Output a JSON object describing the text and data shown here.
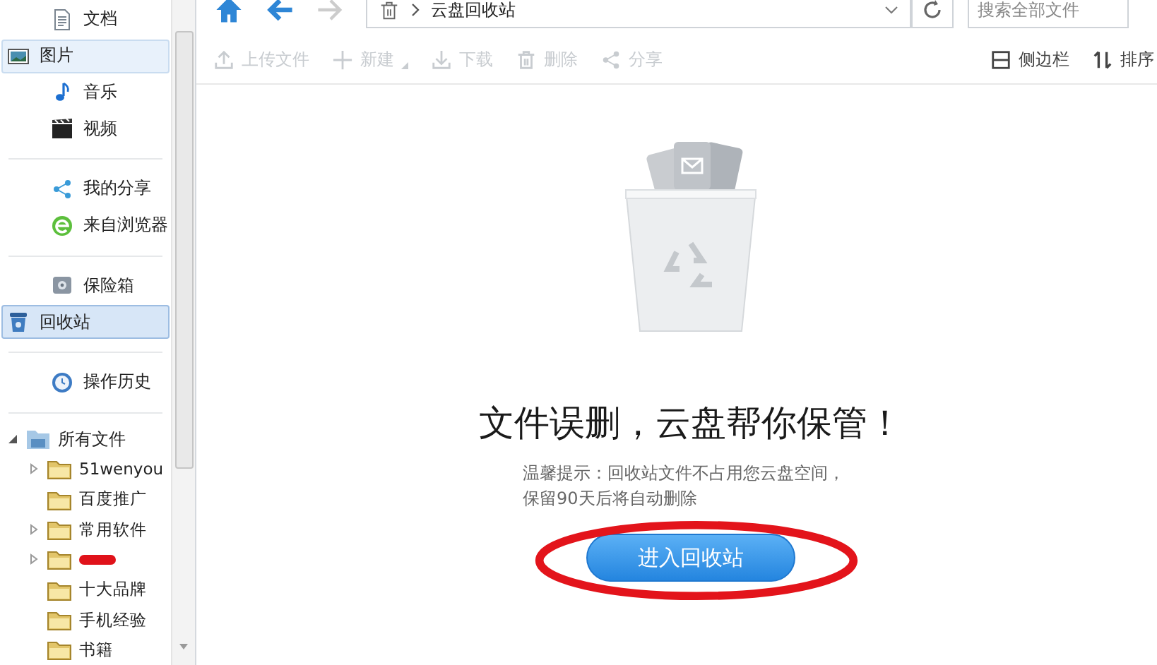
{
  "sidebar": {
    "groups": [
      {
        "items": [
          {
            "label": "文档",
            "selected": false,
            "hover": false
          },
          {
            "label": "图片",
            "selected": false,
            "hover": true
          },
          {
            "label": "音乐",
            "selected": false,
            "hover": false
          },
          {
            "label": "视频",
            "selected": false,
            "hover": false
          }
        ]
      },
      {
        "items": [
          {
            "label": "我的分享",
            "selected": false,
            "hover": false
          },
          {
            "label": "来自浏览器",
            "selected": false,
            "hover": false
          }
        ]
      },
      {
        "items": [
          {
            "label": "保险箱",
            "selected": false,
            "hover": false
          },
          {
            "label": "回收站",
            "selected": true,
            "hover": false
          }
        ]
      },
      {
        "items": [
          {
            "label": "操作历史",
            "selected": false,
            "hover": false
          }
        ]
      }
    ],
    "tree": {
      "label": "所有文件",
      "expanded": true,
      "children": [
        {
          "label": "51wenyou",
          "expandable": true
        },
        {
          "label": "百度推广",
          "expandable": false
        },
        {
          "label": "常用软件",
          "expandable": true
        },
        {
          "expandable": true,
          "redacted": true
        },
        {
          "label": "十大品牌",
          "expandable": false
        },
        {
          "label": "手机经验",
          "expandable": false
        },
        {
          "label": "书籍",
          "expandable": false
        }
      ]
    }
  },
  "nav": {
    "back_disabled": false,
    "forward_disabled": true,
    "path": "云盘回收站",
    "search": {
      "placeholder": "搜索全部文件"
    }
  },
  "toolbar": {
    "left": [
      {
        "label": "上传文件",
        "disabled": true
      },
      {
        "label": "新建",
        "disabled": true,
        "dropdown": true
      },
      {
        "label": "下载",
        "disabled": true
      },
      {
        "label": "删除",
        "disabled": true
      },
      {
        "label": "分享",
        "disabled": true
      }
    ],
    "right": [
      {
        "label": "侧边栏",
        "disabled": false
      },
      {
        "label": "排序",
        "disabled": false
      }
    ]
  },
  "content": {
    "headline": "文件误删，云盘帮你保管！",
    "tip": [
      "温馨提示：回收站文件不占用您云盘空间，",
      "保留90天后将自动删除"
    ],
    "button": "进入回收站",
    "annotation_circle": true
  }
}
